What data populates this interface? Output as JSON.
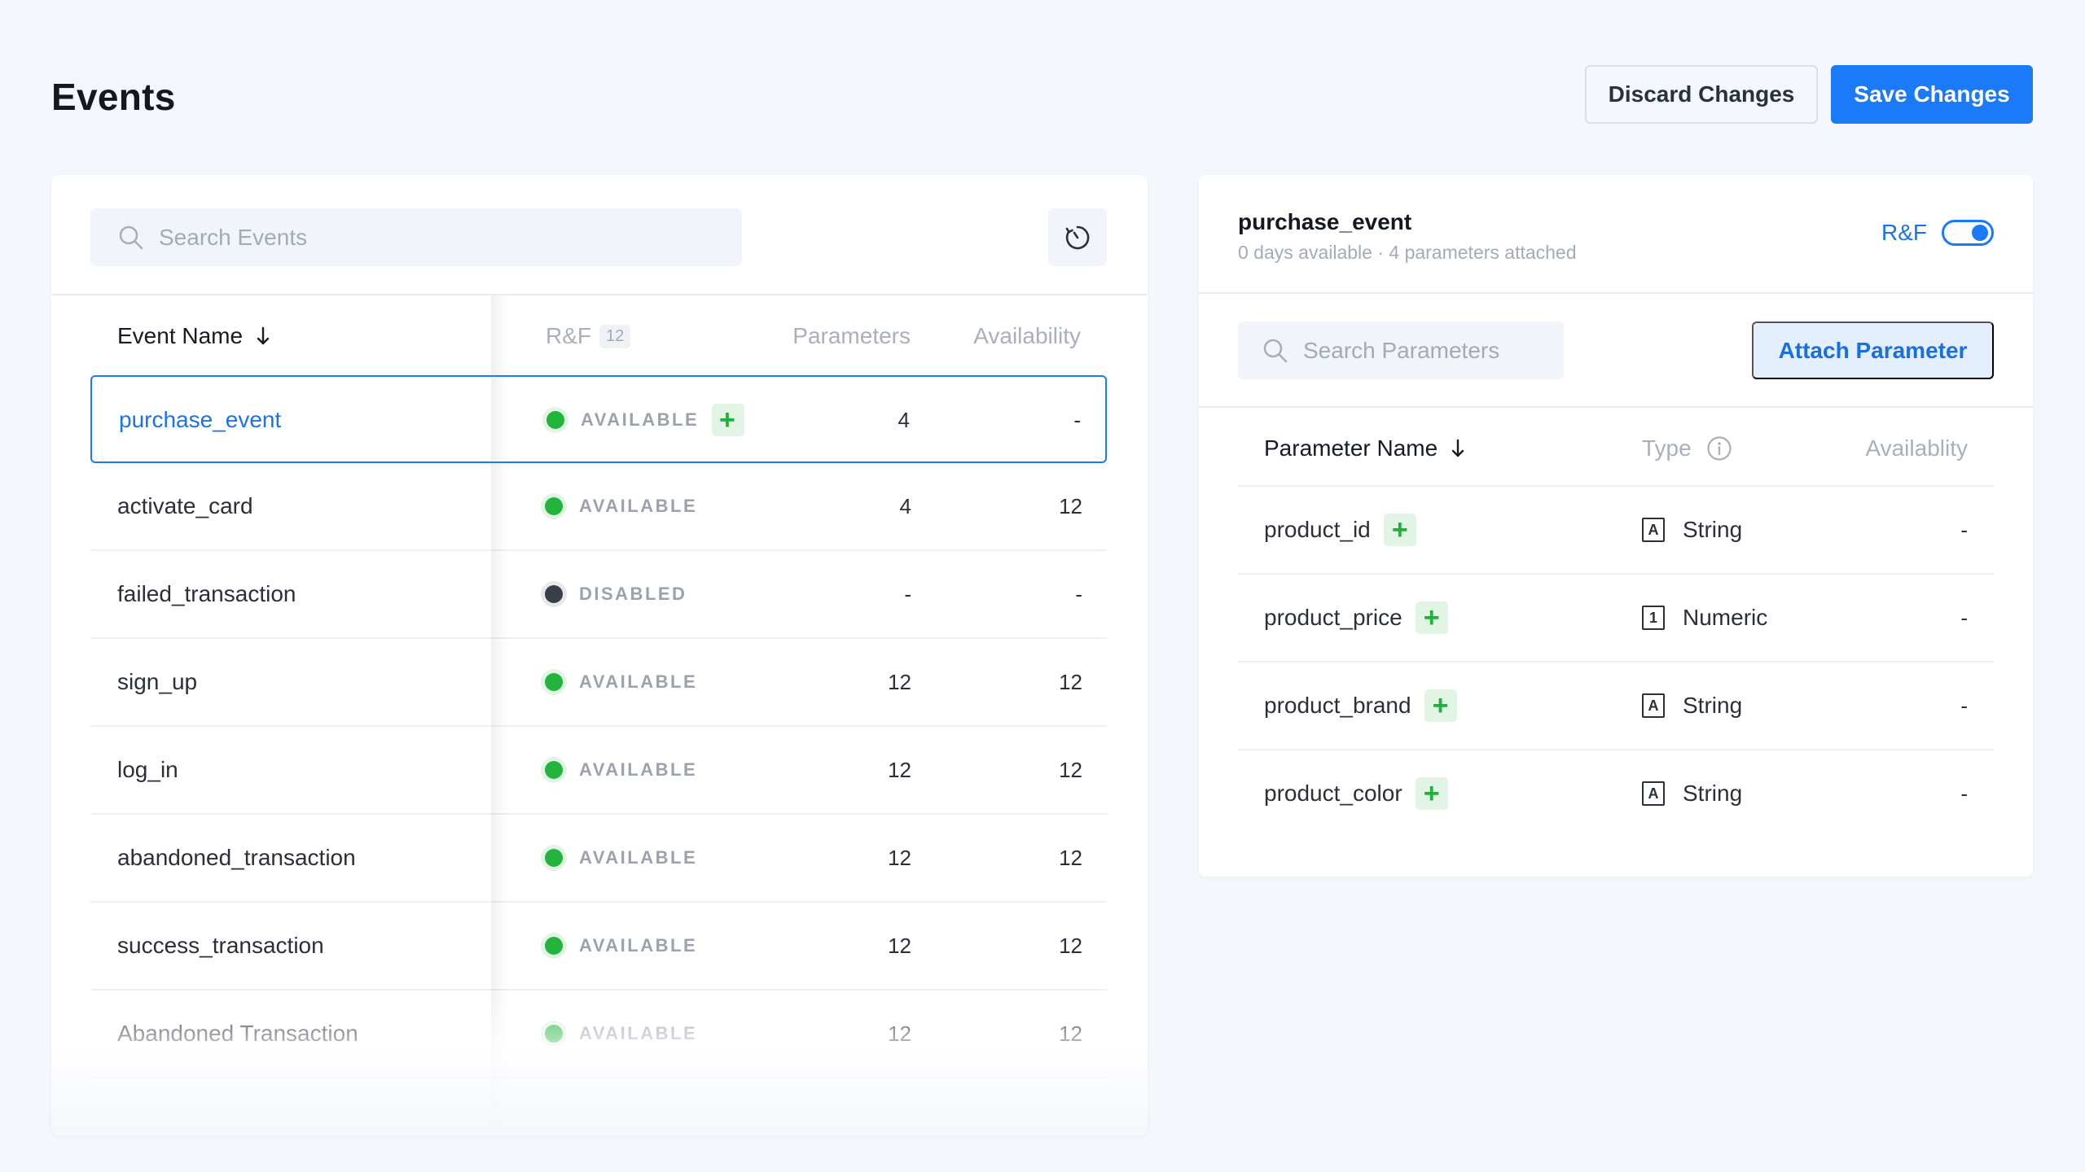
{
  "page": {
    "title": "Events",
    "discard_label": "Discard Changes",
    "save_label": "Save Changes"
  },
  "events_panel": {
    "search_placeholder": "Search Events",
    "columns": {
      "name": "Event Name",
      "rf": "R&F",
      "rf_count": "12",
      "parameters": "Parameters",
      "availability": "Availability"
    },
    "rows": [
      {
        "name": "purchase_event",
        "status": "AVAILABLE",
        "parameters": "4",
        "availability": "-"
      },
      {
        "name": "activate_card",
        "status": "AVAILABLE",
        "parameters": "4",
        "availability": "12"
      },
      {
        "name": "failed_transaction",
        "status": "DISABLED",
        "parameters": "-",
        "availability": "-"
      },
      {
        "name": "sign_up",
        "status": "AVAILABLE",
        "parameters": "12",
        "availability": "12"
      },
      {
        "name": "log_in",
        "status": "AVAILABLE",
        "parameters": "12",
        "availability": "12"
      },
      {
        "name": "abandoned_transaction",
        "status": "AVAILABLE",
        "parameters": "12",
        "availability": "12"
      },
      {
        "name": "success_transaction",
        "status": "AVAILABLE",
        "parameters": "12",
        "availability": "12"
      },
      {
        "name": "Abandoned Transaction",
        "status": "AVAILABLE",
        "parameters": "12",
        "availability": "12"
      }
    ],
    "status_colors": {
      "available": "#22b43c",
      "disabled": "#3a3f47"
    },
    "selected_row": "purchase_event"
  },
  "details_panel": {
    "event_name": "purchase_event",
    "subtitle": "0 days available · 4 parameters attached",
    "rf_label": "R&F",
    "search_placeholder": "Search Parameters",
    "attach_label": "Attach Parameter",
    "columns": {
      "name": "Parameter Name",
      "type": "Type",
      "availability": "Availablity"
    },
    "rows": [
      {
        "name": "product_id",
        "type_icon": "A",
        "type": "String",
        "availability": "-"
      },
      {
        "name": "product_price",
        "type_icon": "1",
        "type": "Numeric",
        "availability": "-"
      },
      {
        "name": "product_brand",
        "type_icon": "A",
        "type": "String",
        "availability": "-"
      },
      {
        "name": "product_color",
        "type_icon": "A",
        "type": "String",
        "availability": "-"
      }
    ]
  },
  "colors": {
    "accent": "#1a7af8",
    "background": "#f4f7fb"
  }
}
